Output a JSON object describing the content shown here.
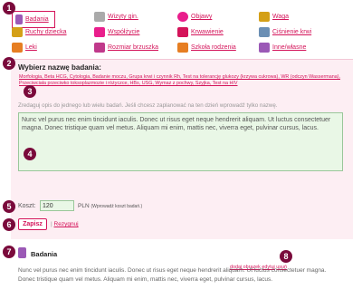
{
  "categories": [
    {
      "label": "Badania",
      "icon": "flask-icon",
      "color": "#9b59b6"
    },
    {
      "label": "Wizyty gin.",
      "icon": "doctor-icon",
      "color": "#aaaaaa"
    },
    {
      "label": "Objawy",
      "icon": "flower-icon",
      "color": "#e91e8c"
    },
    {
      "label": "Waga",
      "icon": "scale-icon",
      "color": "#d4a017"
    },
    {
      "label": "Ruchy dziecka",
      "icon": "footprints-icon",
      "color": "#d4a017"
    },
    {
      "label": "Współżycie",
      "icon": "hearts-icon",
      "color": "#e91e8c"
    },
    {
      "label": "Krwawienie",
      "icon": "blood-drop-icon",
      "color": "#d4145a"
    },
    {
      "label": "Ciśnienie krwi",
      "icon": "blood-pressure-icon",
      "color": "#6b8fb4"
    },
    {
      "label": "Leki",
      "icon": "pills-icon",
      "color": "#e67e22"
    },
    {
      "label": "Rozmiar brzuszka",
      "icon": "belly-icon",
      "color": "#c0398b"
    },
    {
      "label": "Szkoła rodzenia",
      "icon": "school-icon",
      "color": "#e67e22"
    },
    {
      "label": "Inne/własne",
      "icon": "pencil-icon",
      "color": "#9b59b6"
    }
  ],
  "form": {
    "heading": "Wybierz nazwę badania:",
    "tests_text": "Morfologia, Beta HCG, Cytologia, Badanie moczu, Grupa krwi i czynnik Rh, Test na tolerancję glukozy (krzywa cukrowa), WR (odczyn Wassermana), Przeciwciała przeciwko toksoplazmozie i różyczce, HBs, USG, Wymaz z pochwy, Szyjka, Test na HIV",
    "hint": "Zredaguj opis do jednego lub wielu badań. Jeśli chcesz zaplanować na ten dzień wprowadź tylko nazwę.",
    "description": "Nunc vel purus nec enim tincidunt iaculis. Donec ut risus eget neque hendrerit aliquam. Ut luctus consectetuer magna. Donec tristique quam vel metus. Aliquam mi enim, mattis nec, viverra eget, pulvinar cursus, lacus.",
    "cost_label": "Koszt:",
    "cost_value": "120",
    "currency": "PLN",
    "cost_hint": "(Wprowadź koszt badań.)",
    "save_label": "Zapisz",
    "cancel_separator": "|",
    "cancel_label": "Rezygnuj"
  },
  "result": {
    "title": "Badania",
    "add_image": "dodaj obrazek",
    "edit": "edytuj",
    "delete": "usuń",
    "text": "Nunc vel purus nec enim tincidunt iaculis. Donec ut risus eget neque hendrerit aliquam. Ut luctus consectetuer magna. Donec tristique quam vel metus. Aliquam mi enim, mattis nec, viverra eget, pulvinar cursus, lacus."
  },
  "markers": [
    "1",
    "2",
    "3",
    "4",
    "5",
    "6",
    "7",
    "8"
  ]
}
